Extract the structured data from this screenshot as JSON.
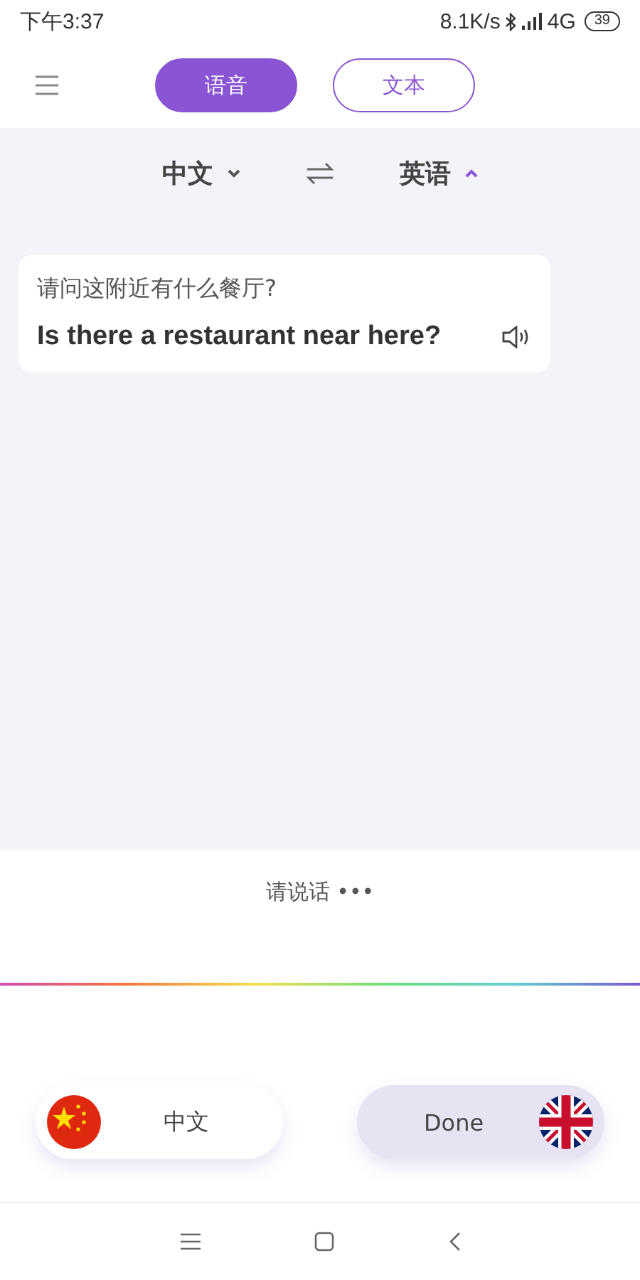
{
  "status_bar": {
    "time": "下午3:37",
    "speed": "8.1K/s",
    "network": "4G",
    "battery": "39"
  },
  "tabs": [
    {
      "label": "语音",
      "selected": true
    },
    {
      "label": "文本",
      "selected": false
    }
  ],
  "languages": [
    {
      "label": "中文",
      "expanded": false
    },
    {
      "label": "英语",
      "expanded": true
    }
  ],
  "messages": [
    {
      "source": "请问这附近有什么餐厅?",
      "translation": "Is there a restaurant near here?"
    }
  ],
  "prompt": "请说话 •••",
  "buttons": [
    {
      "label": "中文",
      "kind": "chinese",
      "selected": false
    },
    {
      "label": "Done",
      "kind": "british",
      "selected": true
    }
  ]
}
